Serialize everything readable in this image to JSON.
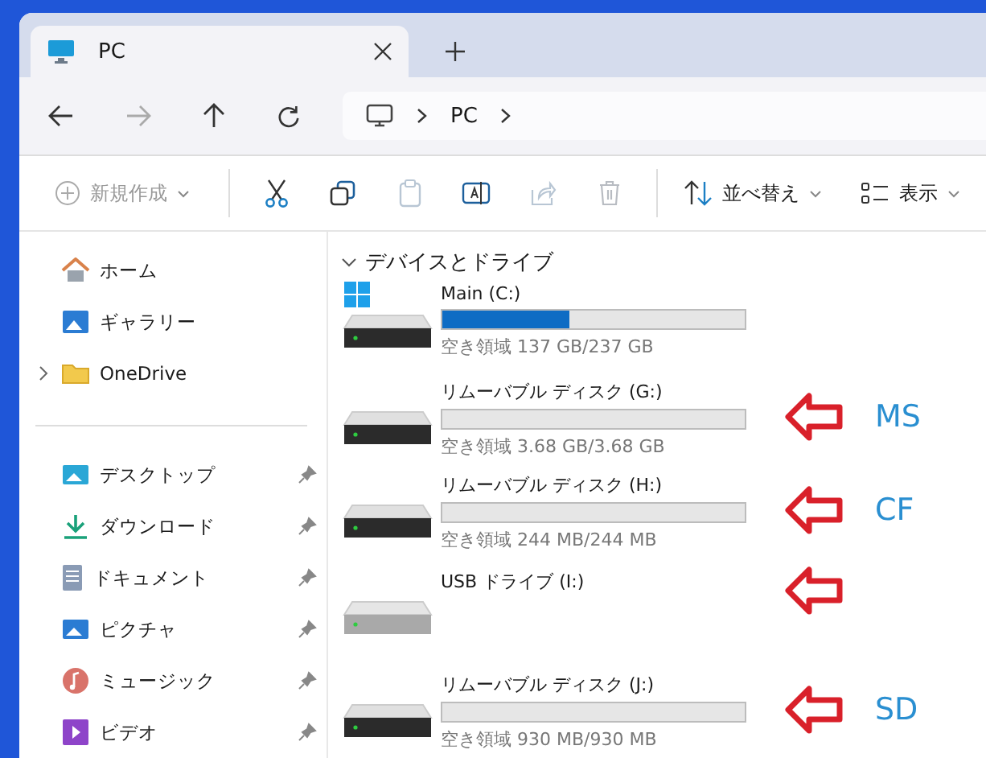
{
  "window": {
    "tab": {
      "title": "PC",
      "selected": true
    }
  },
  "nav": {
    "forward_disabled": true,
    "breadcrumb": [
      "PC"
    ]
  },
  "toolbar": [
    {
      "kind": "new",
      "label": "新規作成",
      "disabled": true
    },
    {
      "kind": "cut",
      "disabled": false
    },
    {
      "kind": "copy",
      "disabled": false
    },
    {
      "kind": "paste",
      "disabled": true
    },
    {
      "kind": "rename",
      "disabled": false
    },
    {
      "kind": "share",
      "disabled": true
    },
    {
      "kind": "delete",
      "disabled": true
    },
    {
      "kind": "sort",
      "label": "並べ替え",
      "disabled": false
    },
    {
      "kind": "view",
      "label": "表示",
      "disabled": false
    }
  ],
  "sidebar": {
    "top": [
      {
        "kind": "home",
        "label": "ホーム",
        "expandable": false
      },
      {
        "kind": "gallery",
        "label": "ギャラリー",
        "expandable": false
      },
      {
        "kind": "folder",
        "label": "OneDrive",
        "expandable": true
      }
    ],
    "quick": [
      {
        "kind": "desktop",
        "label": "デスクトップ",
        "pinned": true
      },
      {
        "kind": "download",
        "label": "ダウンロード",
        "pinned": true
      },
      {
        "kind": "document",
        "label": "ドキュメント",
        "pinned": true
      },
      {
        "kind": "picture",
        "label": "ピクチャ",
        "pinned": true
      },
      {
        "kind": "music",
        "label": "ミュージック",
        "pinned": true
      },
      {
        "kind": "video",
        "label": "ビデオ",
        "pinned": true
      }
    ]
  },
  "section": {
    "title": "デバイスとドライブ",
    "expanded": true
  },
  "drives": [
    {
      "kind": "system",
      "name": "Main (C:)",
      "level": 0.42,
      "free": "空き領域 137 GB/237 GB",
      "arrow": false
    },
    {
      "kind": "disk",
      "name": "リムーバブル ディスク (G:)",
      "level": 0,
      "free": "空き領域 3.68 GB/3.68 GB",
      "arrow": true,
      "annotation": "MS"
    },
    {
      "kind": "disk",
      "name": "リムーバブル ディスク (H:)",
      "level": 0,
      "free": "空き領域 244 MB/244 MB",
      "arrow": true,
      "annotation": "CF"
    },
    {
      "kind": "empty",
      "name": "USB ドライブ (I:)",
      "arrow": true
    },
    {
      "kind": "disk",
      "name": "リムーバブル ディスク (J:)",
      "level": 0,
      "free": "空き領域 930 MB/930 MB",
      "arrow": true,
      "annotation": "SD"
    }
  ]
}
